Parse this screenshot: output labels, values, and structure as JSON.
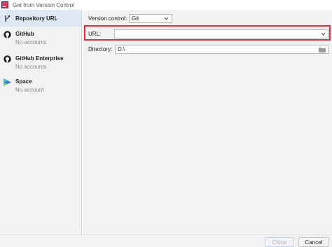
{
  "window": {
    "title": "Get from Version Control"
  },
  "sidebar": {
    "items": [
      {
        "name": "Repository URL",
        "sub": "",
        "icon": "branch-icon"
      },
      {
        "name": "GitHub",
        "sub": "No accounts",
        "icon": "github-icon"
      },
      {
        "name": "GitHub Enterprise",
        "sub": "No accounts",
        "icon": "github-icon"
      },
      {
        "name": "Space",
        "sub": "No account",
        "icon": "space-icon"
      }
    ]
  },
  "form": {
    "version_control_label": "Version control:",
    "version_control_value": "Git",
    "url_label": "URL:",
    "url_value": "",
    "directory_label": "Directory:",
    "directory_value": "D:\\"
  },
  "buttons": {
    "clone": "Clone",
    "cancel": "Cancel"
  },
  "colors": {
    "highlight": "#d9303a",
    "selected": "#dfe8f5",
    "panel": "#f2f2f2"
  }
}
